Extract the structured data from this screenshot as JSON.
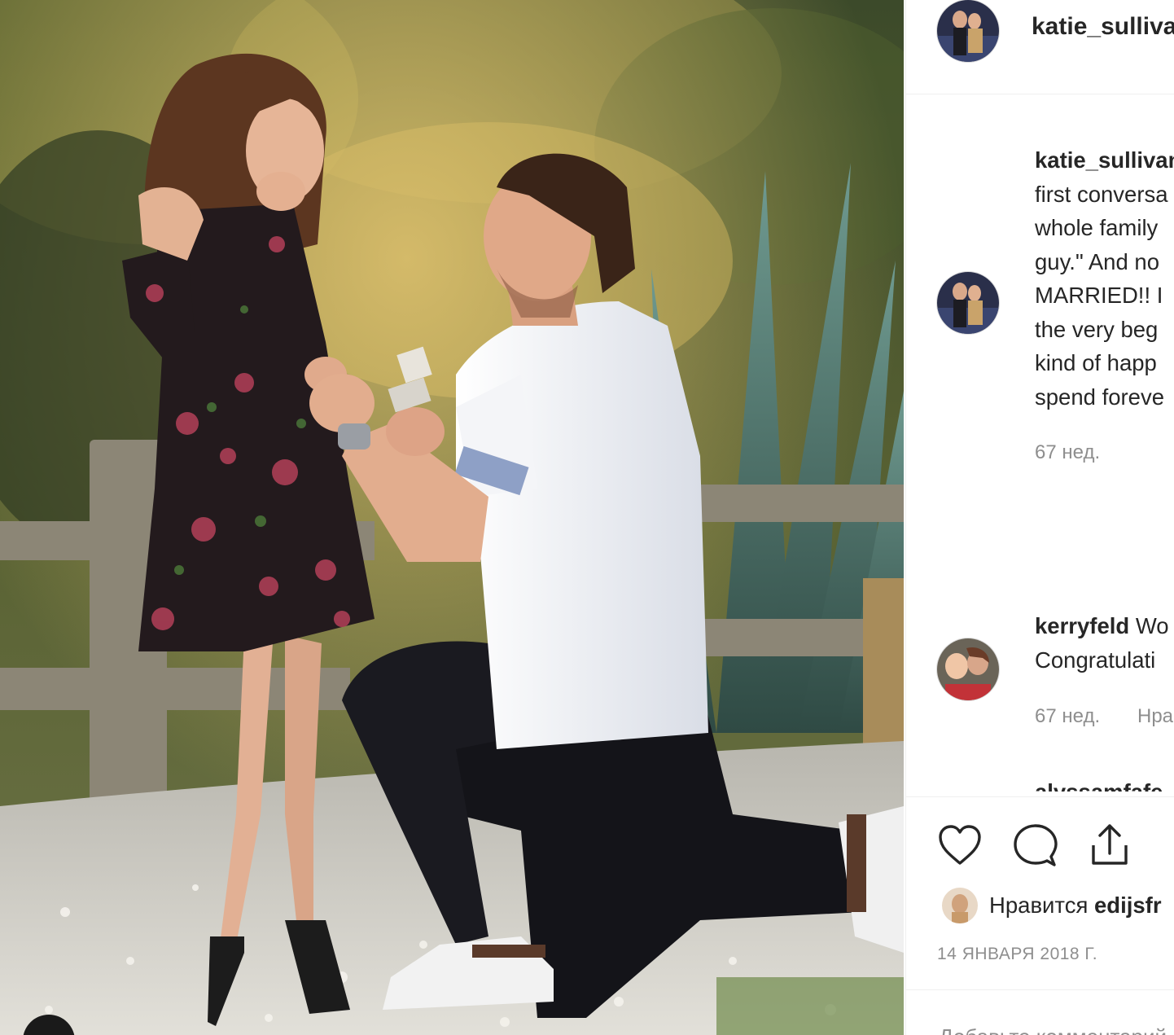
{
  "post": {
    "username": "katie_sullivan_",
    "caption_username": "katie_sullivan_",
    "caption_lines": [
      "first conversa",
      "whole family",
      "guy.\" And no",
      "MARRIED!! I",
      "the very beg",
      "kind of happ",
      "spend foreve"
    ],
    "caption_age": "67 нед."
  },
  "comments": [
    {
      "username": "kerryfeld",
      "text_inline": "Wo",
      "text_line2": "Congratulati",
      "age": "67 нед.",
      "like_label": "Нра"
    },
    {
      "username": "alyssamfafe"
    }
  ],
  "likes": {
    "prefix": "Нравится",
    "username": "edijsfr"
  },
  "date": "14 ЯНВАРЯ 2018 Г.",
  "add_comment_placeholder": "Добавьте комментарий...",
  "icons": {
    "like": "heart-icon",
    "comment": "speech-bubble-icon",
    "share": "share-icon"
  },
  "colors": {
    "text": "#262626",
    "muted": "#8e8e8e",
    "divider": "#efefef"
  }
}
